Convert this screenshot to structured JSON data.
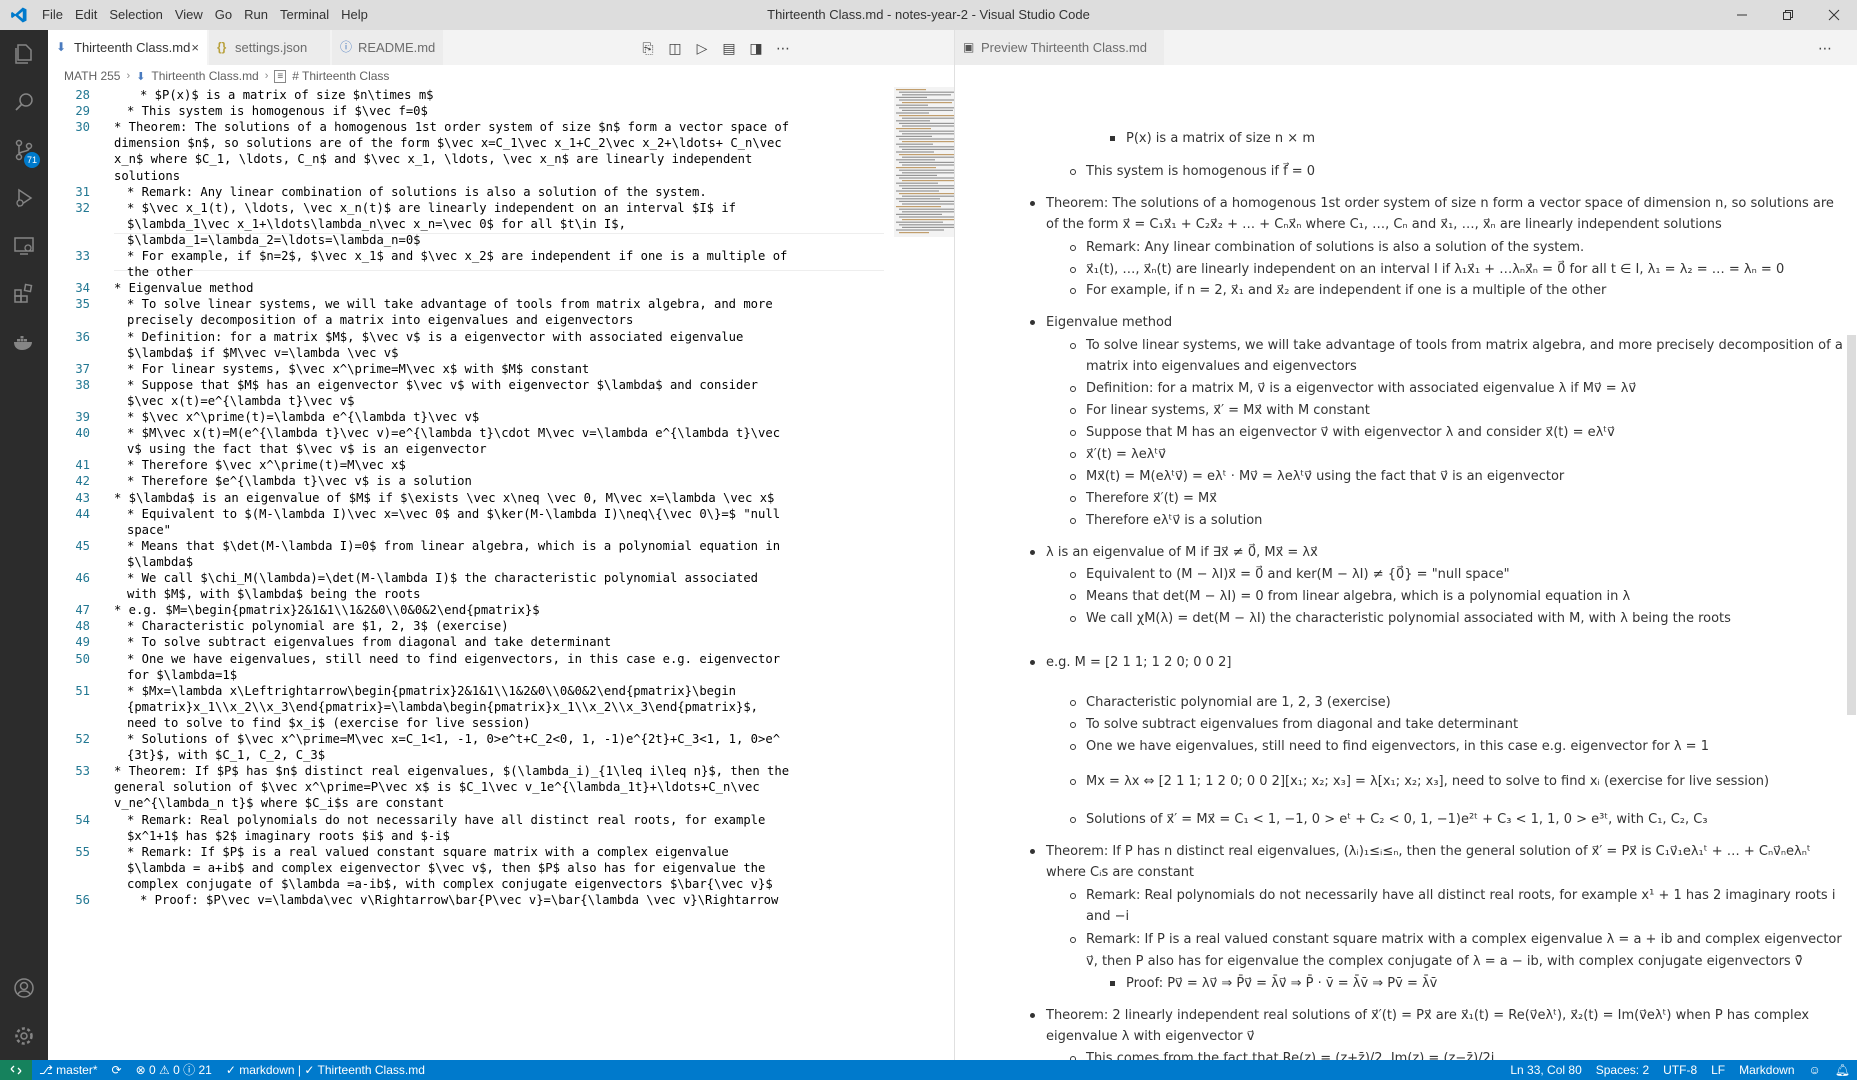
{
  "window": {
    "title": "Thirteenth Class.md - notes-year-2 - Visual Studio Code"
  },
  "menu": [
    "File",
    "Edit",
    "Selection",
    "View",
    "Go",
    "Run",
    "Terminal",
    "Help"
  ],
  "activity": {
    "scm_badge": "71"
  },
  "editor_tabs": [
    {
      "label": "Thirteenth Class.md",
      "icon": "markdown-icon",
      "active": true
    },
    {
      "label": "settings.json",
      "icon": "braces-icon",
      "active": false
    },
    {
      "label": "README.md",
      "icon": "info-icon",
      "active": false
    }
  ],
  "breadcrumb": [
    "MATH 255",
    "Thirteenth Class.md",
    "# Thirteenth Class"
  ],
  "code_lines": [
    {
      "n": "28",
      "indent": 2,
      "text": "* $P(x)$ is a matrix of size $n\\times m$"
    },
    {
      "n": "29",
      "indent": 1,
      "text": "* This system is homogenous if $\\vec f=0$"
    },
    {
      "n": "30",
      "indent": 0,
      "text": "* Theorem: The solutions of a homogenous 1st order system of size $n$ form a vector space of"
    },
    {
      "n": "",
      "indent": 0,
      "text": "dimension $n$, so solutions are of the form $\\vec x=C_1\\vec x_1+C_2\\vec x_2+\\ldots+ C_n\\vec"
    },
    {
      "n": "",
      "indent": 0,
      "text": "x_n$ where $C_1, \\ldots, C_n$ and $\\vec x_1, \\ldots, \\vec x_n$ are linearly independent"
    },
    {
      "n": "",
      "indent": 0,
      "text": "solutions"
    },
    {
      "n": "31",
      "indent": 1,
      "text": "* Remark: Any linear combination of solutions is also a solution of the system."
    },
    {
      "n": "32",
      "indent": 1,
      "text": "* $\\vec x_1(t), \\ldots, \\vec x_n(t)$ are linearly independent on an interval $I$ if"
    },
    {
      "n": "",
      "indent": 1,
      "text": "$\\lambda_1\\vec x_1+\\ldots\\lambda_n\\vec x_n=\\vec 0$ for all $t\\in I$,"
    },
    {
      "n": "",
      "indent": 1,
      "text": "$\\lambda_1=\\lambda_2=\\ldots=\\lambda_n=0$"
    },
    {
      "n": "33",
      "indent": 1,
      "text": "* For example, if $n=2$, $\\vec x_1$ and $\\vec x_2$ are independent if one is a multiple of"
    },
    {
      "n": "",
      "indent": 1,
      "text": "the other"
    },
    {
      "n": "34",
      "indent": 0,
      "text": "* Eigenvalue method"
    },
    {
      "n": "35",
      "indent": 1,
      "text": "* To solve linear systems, we will take advantage of tools from matrix algebra, and more"
    },
    {
      "n": "",
      "indent": 1,
      "text": "precisely decomposition of a matrix into eigenvalues and eigenvectors"
    },
    {
      "n": "36",
      "indent": 1,
      "text": "* Definition: for a matrix $M$, $\\vec v$ is a eigenvector with associated eigenvalue"
    },
    {
      "n": "",
      "indent": 1,
      "text": "$\\lambda$ if $M\\vec v=\\lambda \\vec v$"
    },
    {
      "n": "37",
      "indent": 1,
      "text": "* For linear systems, $\\vec x^\\prime=M\\vec x$ with $M$ constant"
    },
    {
      "n": "38",
      "indent": 1,
      "text": "* Suppose that $M$ has an eigenvector $\\vec v$ with eigenvector $\\lambda$ and consider"
    },
    {
      "n": "",
      "indent": 1,
      "text": "$\\vec x(t)=e^{\\lambda t}\\vec v$"
    },
    {
      "n": "39",
      "indent": 1,
      "text": "* $\\vec x^\\prime(t)=\\lambda e^{\\lambda t}\\vec v$"
    },
    {
      "n": "40",
      "indent": 1,
      "text": "* $M\\vec x(t)=M(e^{\\lambda t}\\vec v)=e^{\\lambda t}\\cdot M\\vec v=\\lambda e^{\\lambda t}\\vec"
    },
    {
      "n": "",
      "indent": 1,
      "text": "v$ using the fact that $\\vec v$ is an eigenvector"
    },
    {
      "n": "41",
      "indent": 1,
      "text": "* Therefore $\\vec x^\\prime(t)=M\\vec x$"
    },
    {
      "n": "42",
      "indent": 1,
      "text": "* Therefore $e^{\\lambda t}\\vec v$ is a solution"
    },
    {
      "n": "43",
      "indent": 0,
      "text": "* $\\lambda$ is an eigenvalue of $M$ if $\\exists \\vec x\\neq \\vec 0, M\\vec x=\\lambda \\vec x$"
    },
    {
      "n": "44",
      "indent": 1,
      "text": "* Equivalent to $(M-\\lambda I)\\vec x=\\vec 0$ and $\\ker(M-\\lambda I)\\neq\\{\\vec 0\\}=$ \"null"
    },
    {
      "n": "",
      "indent": 1,
      "text": "space\""
    },
    {
      "n": "45",
      "indent": 1,
      "text": "* Means that $\\det(M-\\lambda I)=0$ from linear algebra, which is a polynomial equation in"
    },
    {
      "n": "",
      "indent": 1,
      "text": "$\\lambda$"
    },
    {
      "n": "46",
      "indent": 1,
      "text": "* We call $\\chi_M(\\lambda)=\\det(M-\\lambda I)$ the characteristic polynomial associated"
    },
    {
      "n": "",
      "indent": 1,
      "text": "with $M$, with $\\lambda$ being the roots"
    },
    {
      "n": "47",
      "indent": 0,
      "text": "* e.g. $M=\\begin{pmatrix}2&1&1\\\\1&2&0\\\\0&0&2\\end{pmatrix}$"
    },
    {
      "n": "48",
      "indent": 1,
      "text": "* Characteristic polynomial are $1, 2, 3$ (exercise)"
    },
    {
      "n": "49",
      "indent": 1,
      "text": "* To solve subtract eigenvalues from diagonal and take determinant"
    },
    {
      "n": "50",
      "indent": 1,
      "text": "* One we have eigenvalues, still need to find eigenvectors, in this case e.g. eigenvector"
    },
    {
      "n": "",
      "indent": 1,
      "text": "for $\\lambda=1$"
    },
    {
      "n": "51",
      "indent": 1,
      "text": "* $Mx=\\lambda x\\Leftrightarrow\\begin{pmatrix}2&1&1\\\\1&2&0\\\\0&0&2\\end{pmatrix}\\begin"
    },
    {
      "n": "",
      "indent": 1,
      "text": "{pmatrix}x_1\\\\x_2\\\\x_3\\end{pmatrix}=\\lambda\\begin{pmatrix}x_1\\\\x_2\\\\x_3\\end{pmatrix}$,"
    },
    {
      "n": "",
      "indent": 1,
      "text": "need to solve to find $x_i$ (exercise for live session)"
    },
    {
      "n": "52",
      "indent": 1,
      "text": "* Solutions of $\\vec x^\\prime=M\\vec x=C_1<1, -1, 0>e^t+C_2<0, 1, -1)e^{2t}+C_3<1, 1, 0>e^"
    },
    {
      "n": "",
      "indent": 1,
      "text": "{3t}$, with $C_1, C_2, C_3$"
    },
    {
      "n": "53",
      "indent": 0,
      "text": "* Theorem: If $P$ has $n$ distinct real eigenvalues, $(\\lambda_i)_{1\\leq i\\leq n}$, then the"
    },
    {
      "n": "",
      "indent": 0,
      "text": "general solution of $\\vec x^\\prime=P\\vec x$ is $C_1\\vec v_1e^{\\lambda_1t}+\\ldots+C_n\\vec"
    },
    {
      "n": "",
      "indent": 0,
      "text": "v_ne^{\\lambda_n t}$ where $C_i$s are constant"
    },
    {
      "n": "54",
      "indent": 1,
      "text": "* Remark: Real polynomials do not necessarily have all distinct real roots, for example"
    },
    {
      "n": "",
      "indent": 1,
      "text": "$x^1+1$ has $2$ imaginary roots $i$ and $-i$"
    },
    {
      "n": "55",
      "indent": 1,
      "text": "* Remark: If $P$ is a real valued constant square matrix with a complex eigenvalue"
    },
    {
      "n": "",
      "indent": 1,
      "text": "$\\lambda = a+ib$ and complex eigenvector $\\vec v$, then $P$ also has for eigenvalue the"
    },
    {
      "n": "",
      "indent": 1,
      "text": "complex conjugate of $\\lambda =a-ib$, with complex conjugate eigenvectors $\\bar{\\vec v}$"
    },
    {
      "n": "56",
      "indent": 2,
      "text": "* Proof: $P\\vec v=\\lambda\\vec v\\Rightarrow\\bar{P\\vec v}=\\bar{\\lambda \\vec v}\\Rightarrow"
    }
  ],
  "preview_tab": {
    "label": "Preview Thirteenth Class.md"
  },
  "preview_lines": [
    {
      "level": 3,
      "text": "P(x) is a matrix of size n × m",
      "math": true
    },
    {
      "level": 2,
      "text": "This system is homogenous if f⃗ = 0"
    },
    {
      "level": 1,
      "text": "Theorem: The solutions of a homogenous 1st order system of size n form a vector space of dimension n, so solutions are"
    },
    {
      "level": 1,
      "cont": true,
      "text": "of the form x⃗ = C₁x⃗₁ + C₂x⃗₂ + … + Cₙx⃗ₙ where C₁, …, Cₙ and x⃗₁, …, x⃗ₙ are linearly independent solutions"
    },
    {
      "level": 2,
      "text": "Remark: Any linear combination of solutions is also a solution of the system."
    },
    {
      "level": 2,
      "text": "x⃗₁(t), …, x⃗ₙ(t) are linearly independent on an interval I if λ₁x⃗₁ + …λₙx⃗ₙ = 0⃗ for all t ∈ I, λ₁ = λ₂ = … = λₙ = 0"
    },
    {
      "level": 2,
      "text": "For example, if n = 2, x⃗₁ and x⃗₂ are independent if one is a multiple of the other"
    },
    {
      "level": 1,
      "text": "Eigenvalue method"
    },
    {
      "level": 2,
      "text": "To solve linear systems, we will take advantage of tools from matrix algebra, and more precisely decomposition of a"
    },
    {
      "level": 2,
      "cont": true,
      "text": "matrix into eigenvalues and eigenvectors"
    },
    {
      "level": 2,
      "text": "Definition: for a matrix M, v⃗ is a eigenvector with associated eigenvalue λ if Mv⃗ = λv⃗"
    },
    {
      "level": 2,
      "text": "For linear systems, x⃗′ = Mx⃗ with M constant"
    },
    {
      "level": 2,
      "text": "Suppose that M has an eigenvector v⃗ with eigenvector λ and consider x⃗(t) = eλᵗv⃗"
    },
    {
      "level": 2,
      "text": "x⃗′(t) = λeλᵗv⃗"
    },
    {
      "level": 2,
      "text": "Mx⃗(t) = M(eλᵗv⃗) = eλᵗ · Mv⃗ = λeλᵗv⃗ using the fact that v⃗ is an eigenvector"
    },
    {
      "level": 2,
      "text": "Therefore x⃗′(t) = Mx⃗"
    },
    {
      "level": 2,
      "text": "Therefore eλᵗv⃗ is a solution"
    },
    {
      "level": 1,
      "text": "λ is an eigenvalue of M if ∃x⃗ ≠ 0⃗, Mx⃗ = λx⃗"
    },
    {
      "level": 2,
      "text": "Equivalent to (M − λI)x⃗ = 0⃗ and ker(M − λI) ≠ {0⃗} = \"null space\""
    },
    {
      "level": 2,
      "text": "Means that det(M − λI) = 0 from linear algebra, which is a polynomial equation in λ"
    },
    {
      "level": 2,
      "text": "We call χM(λ) = det(M − λI) the characteristic polynomial associated with M, with λ being the roots"
    },
    {
      "level": 1,
      "text": "e.g. M = [2 1 1; 1 2 0; 0 0 2]"
    },
    {
      "level": 2,
      "text": "Characteristic polynomial are 1, 2, 3 (exercise)"
    },
    {
      "level": 2,
      "text": "To solve subtract eigenvalues from diagonal and take determinant"
    },
    {
      "level": 2,
      "text": "One we have eigenvalues, still need to find eigenvectors, in this case e.g. eigenvector for λ = 1"
    },
    {
      "level": 2,
      "text": "Mx = λx ⇔ [2 1 1; 1 2 0; 0 0 2][x₁; x₂; x₃] = λ[x₁; x₂; x₃], need to solve to find xᵢ (exercise for live session)"
    },
    {
      "level": 2,
      "text": "Solutions of x⃗′ = Mx⃗ = C₁ < 1, −1, 0 > eᵗ + C₂ < 0, 1, −1)e²ᵗ + C₃ < 1, 1, 0 > e³ᵗ, with C₁, C₂, C₃"
    },
    {
      "level": 1,
      "text": "Theorem: If P has n distinct real eigenvalues, (λᵢ)₁≤ᵢ≤ₙ, then the general solution of x⃗′ = Px⃗ is C₁v⃗₁eλ₁ᵗ + … + Cₙv⃗ₙeλₙᵗ"
    },
    {
      "level": 1,
      "cont": true,
      "text": "where Cᵢs are constant"
    },
    {
      "level": 2,
      "text": "Remark: Real polynomials do not necessarily have all distinct real roots, for example x¹ + 1 has 2 imaginary roots i"
    },
    {
      "level": 2,
      "cont": true,
      "text": "and −i"
    },
    {
      "level": 2,
      "text": "Remark: If P is a real valued constant square matrix with a complex eigenvalue λ = a + ib and complex eigenvector"
    },
    {
      "level": 2,
      "cont": true,
      "text": "v⃗, then P also has for eigenvalue the complex conjugate of λ = a − ib, with complex conjugate eigenvectors v̄⃗"
    },
    {
      "level": 3,
      "text": "Proof: Pv⃗ = λv⃗ ⇒ P̄v⃗ = λ̄v⃗ ⇒ P̄ · v̄ = λ̄v̄ ⇒ Pv̄ = λ̄v̄"
    },
    {
      "level": 1,
      "text": "Theorem: 2 linearly independent real solutions of x⃗′(t) = Px⃗ are x⃗₁(t) = Re(v⃗eλᵗ), x⃗₂(t) = Im(v⃗eλᵗ) when P has complex"
    },
    {
      "level": 1,
      "cont": true,
      "text": "eigenvalue λ with eigenvector v⃗"
    },
    {
      "level": 2,
      "text": "This comes from the fact that Re(z) = (z+z̄)/2, Im(z) = (z−z̄)/2i"
    }
  ],
  "statusbar": {
    "branch": "master*",
    "problems": "0",
    "warnings": "0",
    "info": "21",
    "check": "markdown | ✓ Thirteenth Class.md",
    "position": "Ln 33, Col 80",
    "spaces": "Spaces: 2",
    "encoding": "UTF-8",
    "eol": "LF",
    "language": "Markdown"
  },
  "colors": {
    "statusbar": "#007acc",
    "activitybar": "#2c2c2c",
    "titlebar": "#dddddd",
    "accent": "#007acc"
  }
}
